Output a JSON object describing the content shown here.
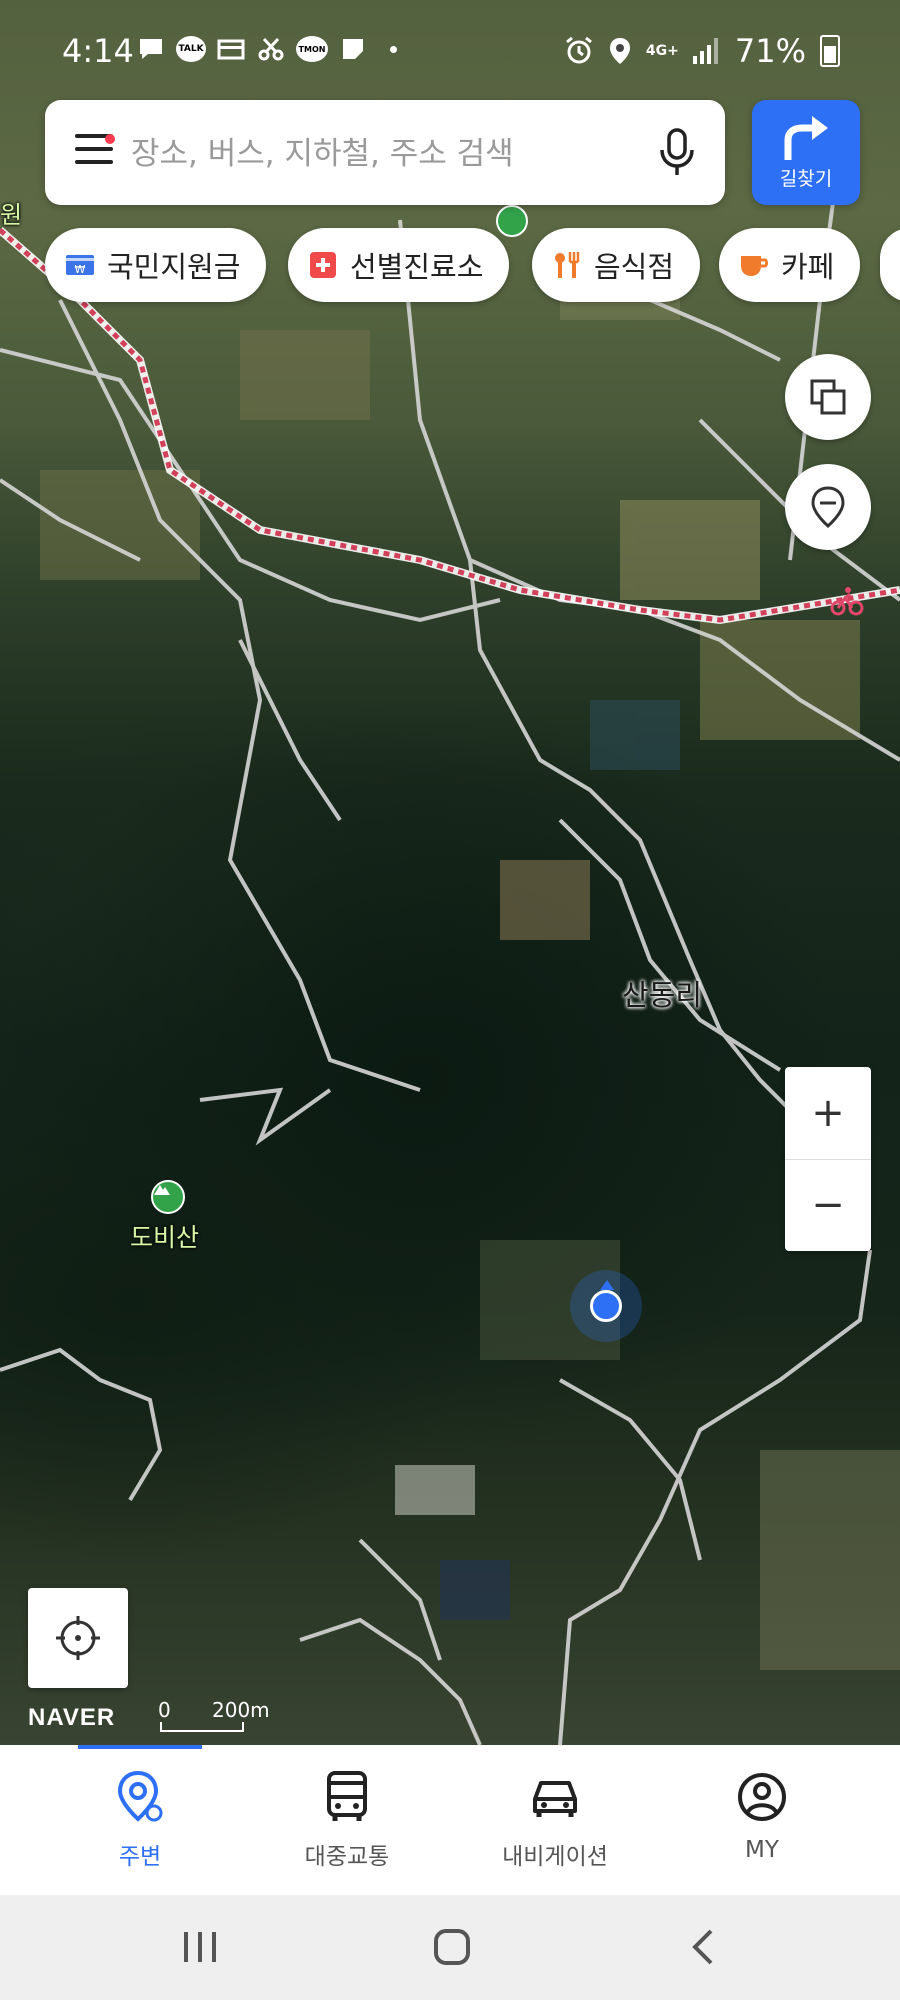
{
  "status_bar": {
    "time": "4:14",
    "notification_icons": [
      "chat-bubble-icon",
      "kakaotalk-icon",
      "wallet-icon",
      "scissors-icon",
      "tmon-icon",
      "note-icon",
      "more-dot-icon"
    ],
    "talk_badge": "TALK",
    "tmon_badge": "TMON",
    "network": "4G+",
    "battery": "71%"
  },
  "search": {
    "placeholder": "장소, 버스, 지하철, 주소 검색"
  },
  "route_button": {
    "label": "길찾기"
  },
  "chips": [
    {
      "label": "국민지원금",
      "icon": "won-card-icon",
      "color": "#3b73e8"
    },
    {
      "label": "선별진료소",
      "icon": "medical-cross-icon",
      "color": "#f04a4a"
    },
    {
      "label": "음식점",
      "icon": "fork-knife-icon",
      "color": "#f07b2c"
    },
    {
      "label": "카페",
      "icon": "coffee-cup-icon",
      "color": "#f07b2c"
    }
  ],
  "map": {
    "labels": {
      "village": "산동리",
      "mountain": "도비산",
      "edge_text": "원"
    },
    "brand": "NAVER",
    "scale_zero": "0",
    "scale_distance": "200m"
  },
  "map_controls": {
    "zoom_in": "+",
    "zoom_out": "−"
  },
  "bottom_nav": {
    "items": [
      {
        "label": "주변",
        "icon": "location-pin-icon",
        "active": true
      },
      {
        "label": "대중교통",
        "icon": "bus-icon",
        "active": false
      },
      {
        "label": "내비게이션",
        "icon": "car-icon",
        "active": false
      },
      {
        "label": "MY",
        "icon": "profile-icon",
        "active": false
      }
    ]
  },
  "colors": {
    "accent": "#2d6ff5",
    "menu_badge": "#ff3b4f"
  }
}
